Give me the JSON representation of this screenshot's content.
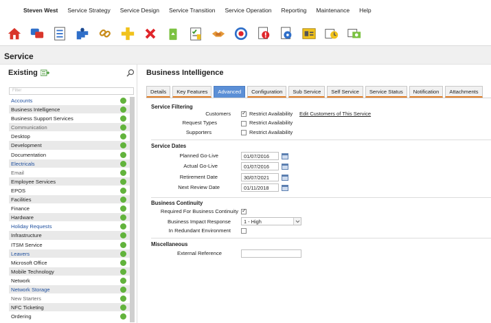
{
  "menubar": {
    "user": "Steven West",
    "items": [
      "Service Strategy",
      "Service Design",
      "Service Transition",
      "Service Operation",
      "Reporting",
      "Maintenance",
      "Help"
    ]
  },
  "toolbar": {
    "icons": [
      "home-icon",
      "chat-icon",
      "list-icon",
      "puzzle-icon",
      "link-icon",
      "add-icon",
      "delete-icon",
      "recycle-icon",
      "checklist-icon",
      "handshake-icon",
      "target-icon",
      "alert-doc-icon",
      "settings-doc-icon",
      "id-card-icon",
      "clock-doc-icon",
      "money-icon"
    ]
  },
  "page": {
    "title": "Service"
  },
  "left": {
    "heading": "Existing",
    "filter_placeholder": "Filter",
    "services": [
      {
        "name": "Accounts",
        "link": true
      },
      {
        "name": "Business Intelligence",
        "link": false
      },
      {
        "name": "Business Support Services",
        "link": false
      },
      {
        "name": "Communication",
        "link": false,
        "muted": true
      },
      {
        "name": "Desktop",
        "link": false
      },
      {
        "name": "Development",
        "link": false
      },
      {
        "name": "Documentation",
        "link": false
      },
      {
        "name": "Electricals",
        "link": true
      },
      {
        "name": "Email",
        "link": false,
        "muted": true
      },
      {
        "name": "Employee Services",
        "link": false
      },
      {
        "name": "EPOS",
        "link": false
      },
      {
        "name": "Facilities",
        "link": false
      },
      {
        "name": "Finance",
        "link": false
      },
      {
        "name": "Hardware",
        "link": false
      },
      {
        "name": "Holiday Requests",
        "link": true
      },
      {
        "name": "Infrastructure",
        "link": false
      },
      {
        "name": "ITSM Service",
        "link": false
      },
      {
        "name": "Leavers",
        "link": true
      },
      {
        "name": "Microsoft Office",
        "link": false
      },
      {
        "name": "Mobile Technology",
        "link": false
      },
      {
        "name": "Network",
        "link": false
      },
      {
        "name": "Network Storage",
        "link": true
      },
      {
        "name": "New Starters",
        "link": false,
        "muted": true
      },
      {
        "name": "NFC Ticketing",
        "link": false
      },
      {
        "name": "Ordering",
        "link": false
      }
    ],
    "status_color": "#62b33c"
  },
  "detail": {
    "title": "Business Intelligence",
    "tabs": [
      "Details",
      "Key Features",
      "Advanced",
      "Configuration",
      "Sub Service",
      "Self Service",
      "Service Status",
      "Notification",
      "Attachments"
    ],
    "active_tab": "Advanced",
    "filtering": {
      "heading": "Service Filtering",
      "customers": "Customers",
      "request_types": "Request Types",
      "supporters": "Supporters",
      "restrict": "Restrict Availability",
      "edit_customers": "Edit Customers of This Service"
    },
    "dates": {
      "heading": "Service Dates",
      "planned_label": "Planned Go-Live",
      "planned": "01/07/2016",
      "actual_label": "Actual Go-Live",
      "actual": "01/07/2016",
      "retirement_label": "Retirement Date",
      "retirement": "30/07/2021",
      "review_label": "Next Review Date",
      "review": "01/11/2018"
    },
    "continuity": {
      "heading": "Business Continuity",
      "required_label": "Required For Business Continuity",
      "impact_label": "Business Impact Response",
      "impact_value": "1 - High",
      "redundant_label": "In Redundant Environment"
    },
    "misc": {
      "heading": "Miscellaneous",
      "external_label": "External Reference",
      "external_value": ""
    }
  }
}
